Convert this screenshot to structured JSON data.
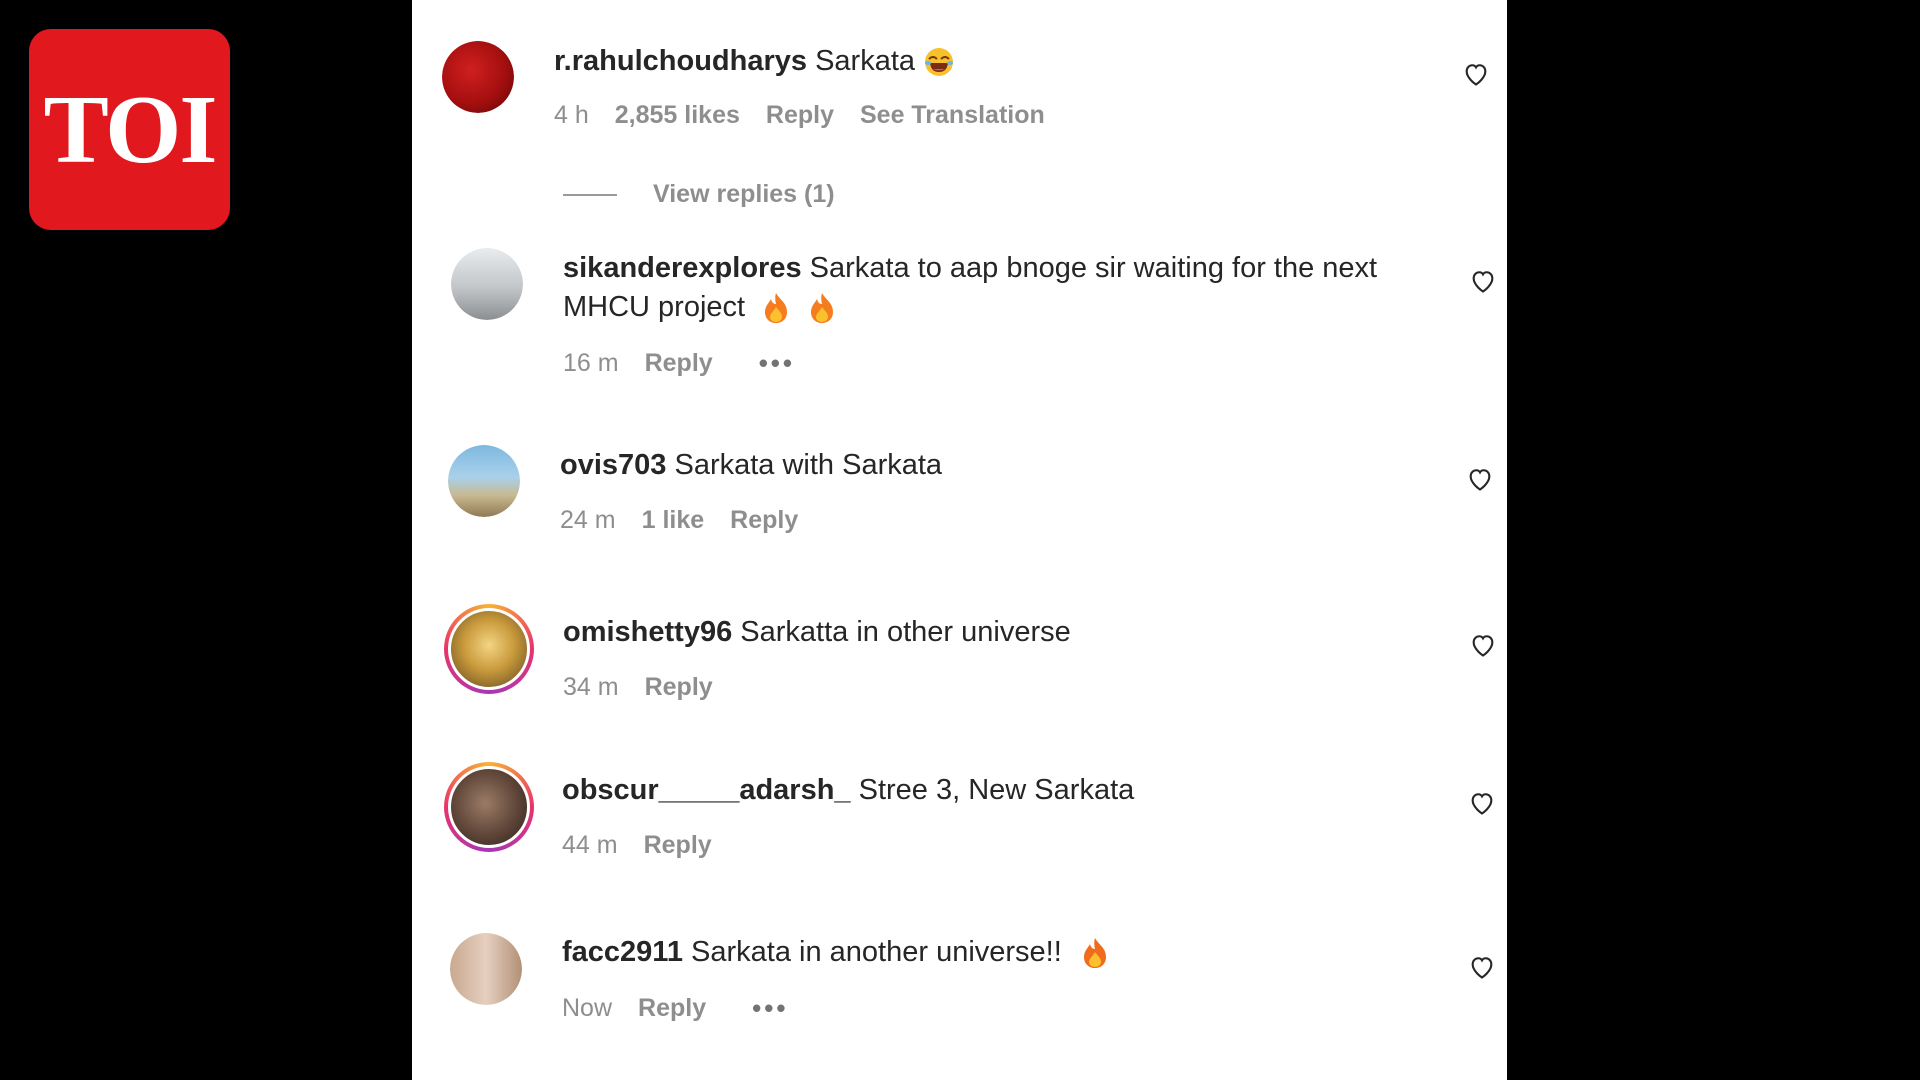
{
  "logo": {
    "text": "TOI",
    "color": "#e1191e"
  },
  "comments": [
    {
      "user": "r.rahulchoudharys",
      "text": "Sarkata",
      "emoji": "laughing-face",
      "time": "4 h",
      "likes": "2,855 likes",
      "reply": "Reply",
      "translate": "See Translation"
    },
    {
      "user": "sikanderexplores",
      "text": "Sarkata to aap bnoge sir waiting for the next MHCU project",
      "emoji": "fire fire",
      "time": "16 m",
      "reply": "Reply",
      "more": "•••"
    },
    {
      "user": "ovis703",
      "text": "Sarkata with Sarkata",
      "time": "24 m",
      "likes": "1 like",
      "reply": "Reply"
    },
    {
      "user": "omishetty96",
      "text": "Sarkatta in other universe",
      "time": "34 m",
      "reply": "Reply"
    },
    {
      "user": "obscur_____adarsh_",
      "text": "Stree 3, New Sarkata",
      "time": "44 m",
      "reply": "Reply"
    },
    {
      "user": "facc2911",
      "text": "Sarkata in another universe!!",
      "emoji": "fire",
      "time": "Now",
      "reply": "Reply",
      "more": "•••"
    }
  ],
  "view_replies": "View replies (1)",
  "icons": {
    "like": "heart-outline-icon",
    "fire": "fire-emoji-icon",
    "laugh": "laughing-emoji-icon"
  }
}
